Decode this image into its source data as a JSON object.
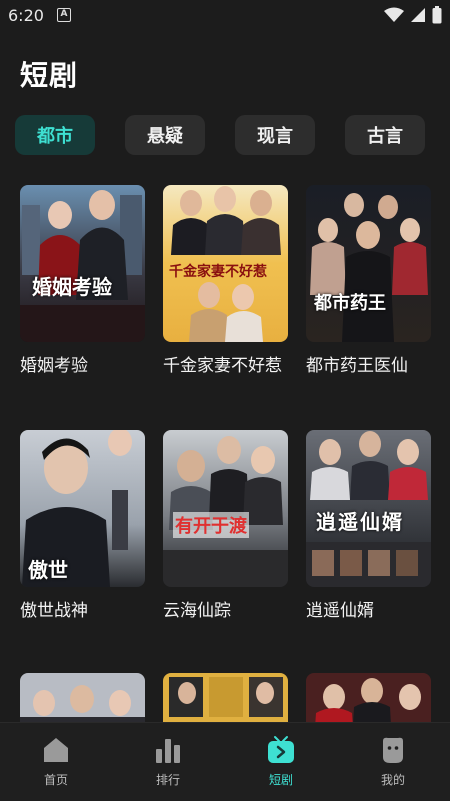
{
  "status": {
    "time": "6:20",
    "app_icon": "A"
  },
  "page": {
    "title": "短剧"
  },
  "colors": {
    "accent": "#3ee0d2",
    "background": "#1c1c1c",
    "chip_bg": "#2d2d2d",
    "chip_active_bg": "#163a38"
  },
  "categories": [
    {
      "label": "都市",
      "active": true
    },
    {
      "label": "悬疑",
      "active": false
    },
    {
      "label": "现言",
      "active": false
    },
    {
      "label": "古言",
      "active": false
    }
  ],
  "dramas": [
    {
      "title": "婚姻考验",
      "poster_text": "婚姻考验"
    },
    {
      "title": "千金家妻不好惹",
      "poster_text": "千金家妻不好惹"
    },
    {
      "title": "都市药王医仙",
      "poster_text": "都市药王"
    },
    {
      "title": "傲世战神",
      "poster_text": "傲世"
    },
    {
      "title": "云海仙踪",
      "poster_text": "有开于渡"
    },
    {
      "title": "逍遥仙婿",
      "poster_text": "逍遥仙婿"
    }
  ],
  "nav": [
    {
      "label": "首页",
      "icon": "home-icon"
    },
    {
      "label": "排行",
      "icon": "ranking-icon"
    },
    {
      "label": "短剧",
      "icon": "short-drama-icon",
      "active": true
    },
    {
      "label": "我的",
      "icon": "profile-icon"
    }
  ]
}
